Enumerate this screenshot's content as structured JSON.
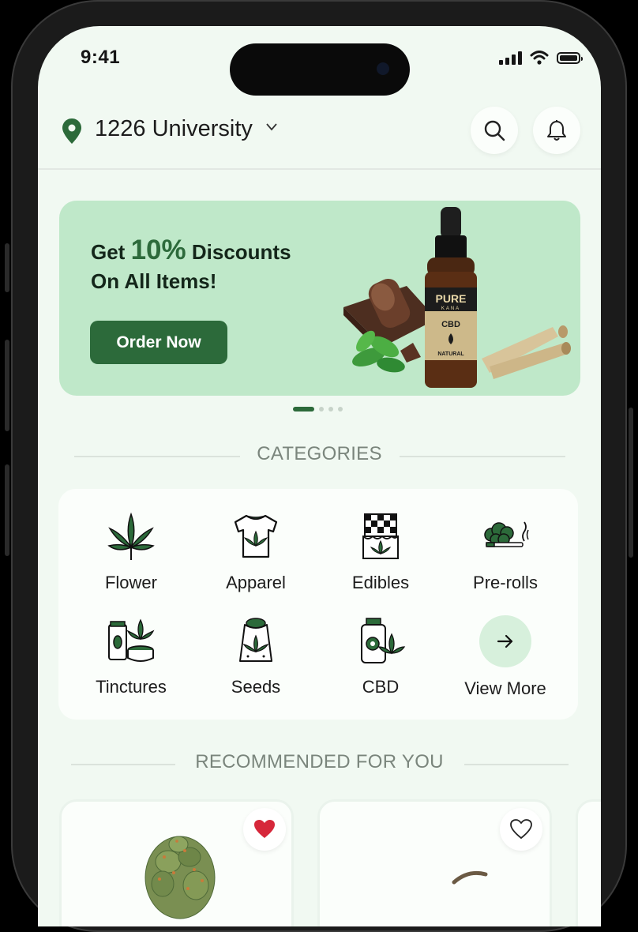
{
  "status_bar": {
    "time": "9:41"
  },
  "header": {
    "location": "1226 University"
  },
  "banner": {
    "line1_prefix": "Get ",
    "line1_highlight": "10%",
    "line1_suffix": " Discounts",
    "line2": "On All Items!",
    "cta_label": "Order Now",
    "product_brand": "PURE",
    "product_sub": "KANA",
    "product_name": "CBD",
    "product_variant": "NATURAL"
  },
  "carousel": {
    "slide_count": 4,
    "active_index": 0
  },
  "categories": {
    "title": "CATEGORIES",
    "items": [
      {
        "label": "Flower",
        "icon": "cannabis-leaf-icon"
      },
      {
        "label": "Apparel",
        "icon": "tshirt-icon"
      },
      {
        "label": "Edibles",
        "icon": "chocolate-bar-icon"
      },
      {
        "label": "Pre-rolls",
        "icon": "pre-roll-icon"
      },
      {
        "label": "Tinctures",
        "icon": "tincture-bottle-icon"
      },
      {
        "label": "Seeds",
        "icon": "seed-bag-icon"
      },
      {
        "label": "CBD",
        "icon": "cbd-jar-icon"
      },
      {
        "label": "View More",
        "icon": "arrow-right-icon"
      }
    ]
  },
  "recommended": {
    "title": "RECOMMENDED FOR YOU",
    "products": [
      {
        "favorited": true
      },
      {
        "favorited": false
      }
    ]
  },
  "colors": {
    "brand_green": "#2c6a3a",
    "screen_bg": "#f1f9f2",
    "banner_bg": "#bfe8c9",
    "favorite_red": "#d6273a"
  }
}
